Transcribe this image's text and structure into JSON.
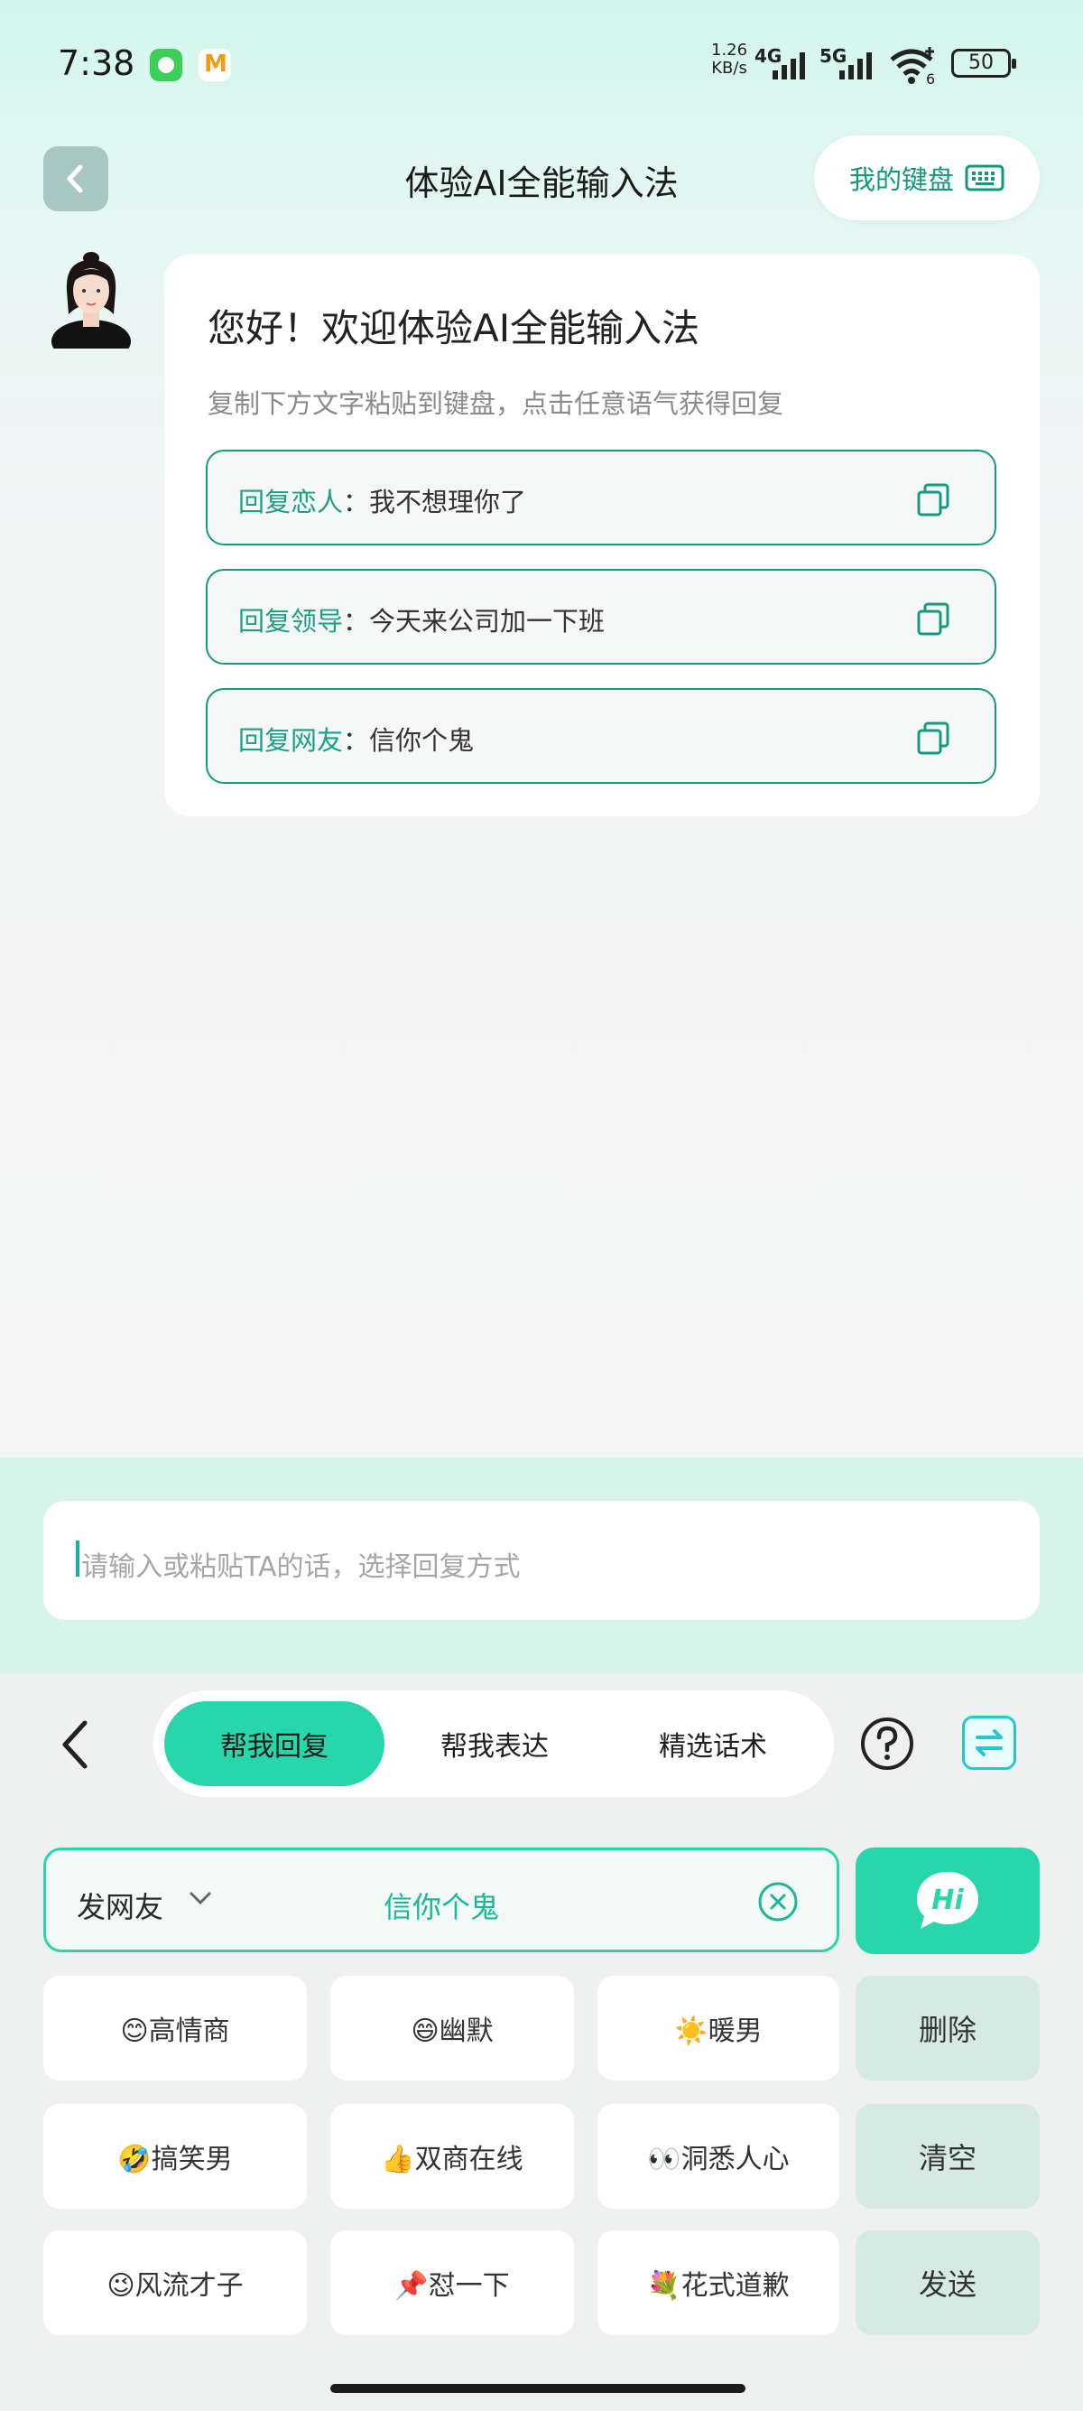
{
  "status_bar": {
    "time": "7:38",
    "net_speed_value": "1.26",
    "net_speed_unit": "KB/s",
    "signal1": "4G",
    "signal2": "5G",
    "wifi_num": "6",
    "battery": "50"
  },
  "header": {
    "title": "体验AI全能输入法",
    "my_keyboard": "我的键盘"
  },
  "welcome": {
    "title": "您好！欢迎体验AI全能输入法",
    "subtitle": "复制下方文字粘贴到键盘，点击任意语气获得回复",
    "items": [
      {
        "label": "回复恋人",
        "text": "：我不想理你了"
      },
      {
        "label": "回复领导",
        "text": "：今天来公司加一下班"
      },
      {
        "label": "回复网友",
        "text": "：信你个鬼"
      }
    ]
  },
  "input": {
    "placeholder": "请输入或粘贴TA的话，选择回复方式"
  },
  "keyboard": {
    "tabs": [
      "帮我回复",
      "帮我表达",
      "精选话术"
    ],
    "active_tab": 0,
    "target_select": "发网友",
    "target_text": "信你个鬼",
    "hi_label": "Hi",
    "tones": [
      [
        "😊高情商",
        "😄幽默",
        "☀️暖男"
      ],
      [
        "🤣搞笑男",
        "👍双商在线",
        "👀洞悉人心"
      ],
      [
        "😉风流才子",
        "📌怼一下",
        "💐花式道歉"
      ]
    ],
    "side_keys": [
      "删除",
      "清空",
      "发送"
    ]
  },
  "colors": {
    "accent": "#27d7ab",
    "accent_dark": "#159a80",
    "side_key_bg": "#d4eae3"
  }
}
